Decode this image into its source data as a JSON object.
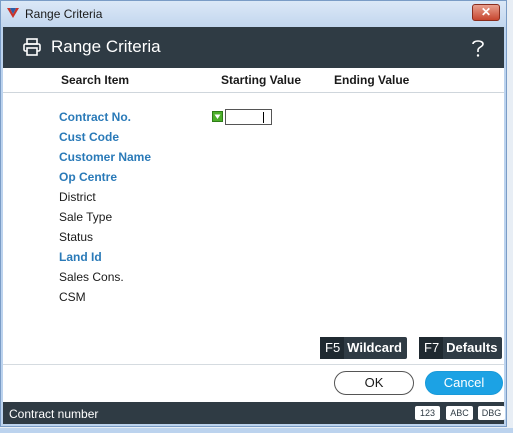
{
  "window": {
    "title": "Range Criteria",
    "close_label": "✕"
  },
  "header": {
    "title": "Range Criteria",
    "help_symbol": "?"
  },
  "columns": {
    "search_item": "Search Item",
    "starting_value": "Starting Value",
    "ending_value": "Ending Value"
  },
  "rows": [
    {
      "label": "Contract No.",
      "style": "link"
    },
    {
      "label": "Cust Code",
      "style": "link"
    },
    {
      "label": "Customer Name",
      "style": "link"
    },
    {
      "label": "Op Centre",
      "style": "link"
    },
    {
      "label": "District",
      "style": "plain"
    },
    {
      "label": "Sale Type",
      "style": "plain"
    },
    {
      "label": "Status",
      "style": "plain"
    },
    {
      "label": "Land Id",
      "style": "link"
    },
    {
      "label": "Sales Cons.",
      "style": "plain"
    },
    {
      "label": "CSM",
      "style": "plain"
    }
  ],
  "starting_value": "",
  "function_keys": {
    "wildcard": {
      "key": "F5",
      "label": "Wildcard"
    },
    "defaults": {
      "key": "F7",
      "label": "Defaults"
    }
  },
  "buttons": {
    "ok": "OK",
    "cancel": "Cancel"
  },
  "status": {
    "text": "Contract number",
    "badges": [
      "123",
      "ABC",
      "DBG"
    ]
  },
  "colors": {
    "link": "#2a7ab8",
    "dark_bar": "#2f3b44",
    "accent": "#1ca2e4"
  }
}
